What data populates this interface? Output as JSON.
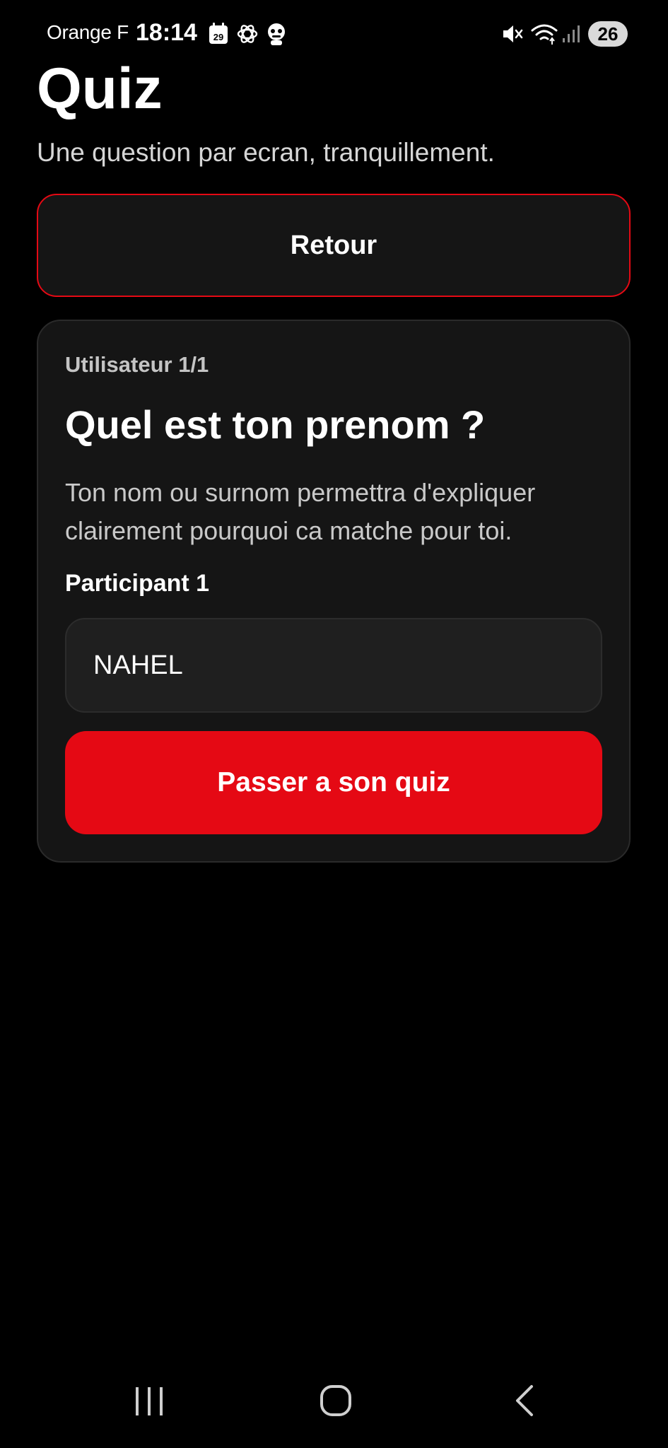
{
  "status_bar": {
    "carrier": "Orange F",
    "time": "18:14",
    "calendar_day": "29",
    "battery": "26",
    "icons": [
      "calendar-icon",
      "openai-icon",
      "bot-face-icon",
      "mute-icon",
      "wifi-icon",
      "signal-icon"
    ]
  },
  "header": {
    "title": "Quiz",
    "subtitle": "Une question par ecran, tranquillement."
  },
  "back_button": {
    "label": "Retour"
  },
  "card": {
    "step": "Utilisateur 1/1",
    "question": "Quel est ton prenom ?",
    "description": "Ton nom ou surnom permettra d'expliquer clairement pourquoi ca matche pour toi.",
    "field_label": "Participant 1",
    "field_value": "NAHEL",
    "submit_label": "Passer a son quiz"
  },
  "nav_bar": {
    "icons": [
      "recent-apps-icon",
      "home-icon",
      "back-icon"
    ]
  },
  "colors": {
    "background": "#000000",
    "card": "#151515",
    "accent": "#e50914",
    "input": "#1f1f1f"
  }
}
